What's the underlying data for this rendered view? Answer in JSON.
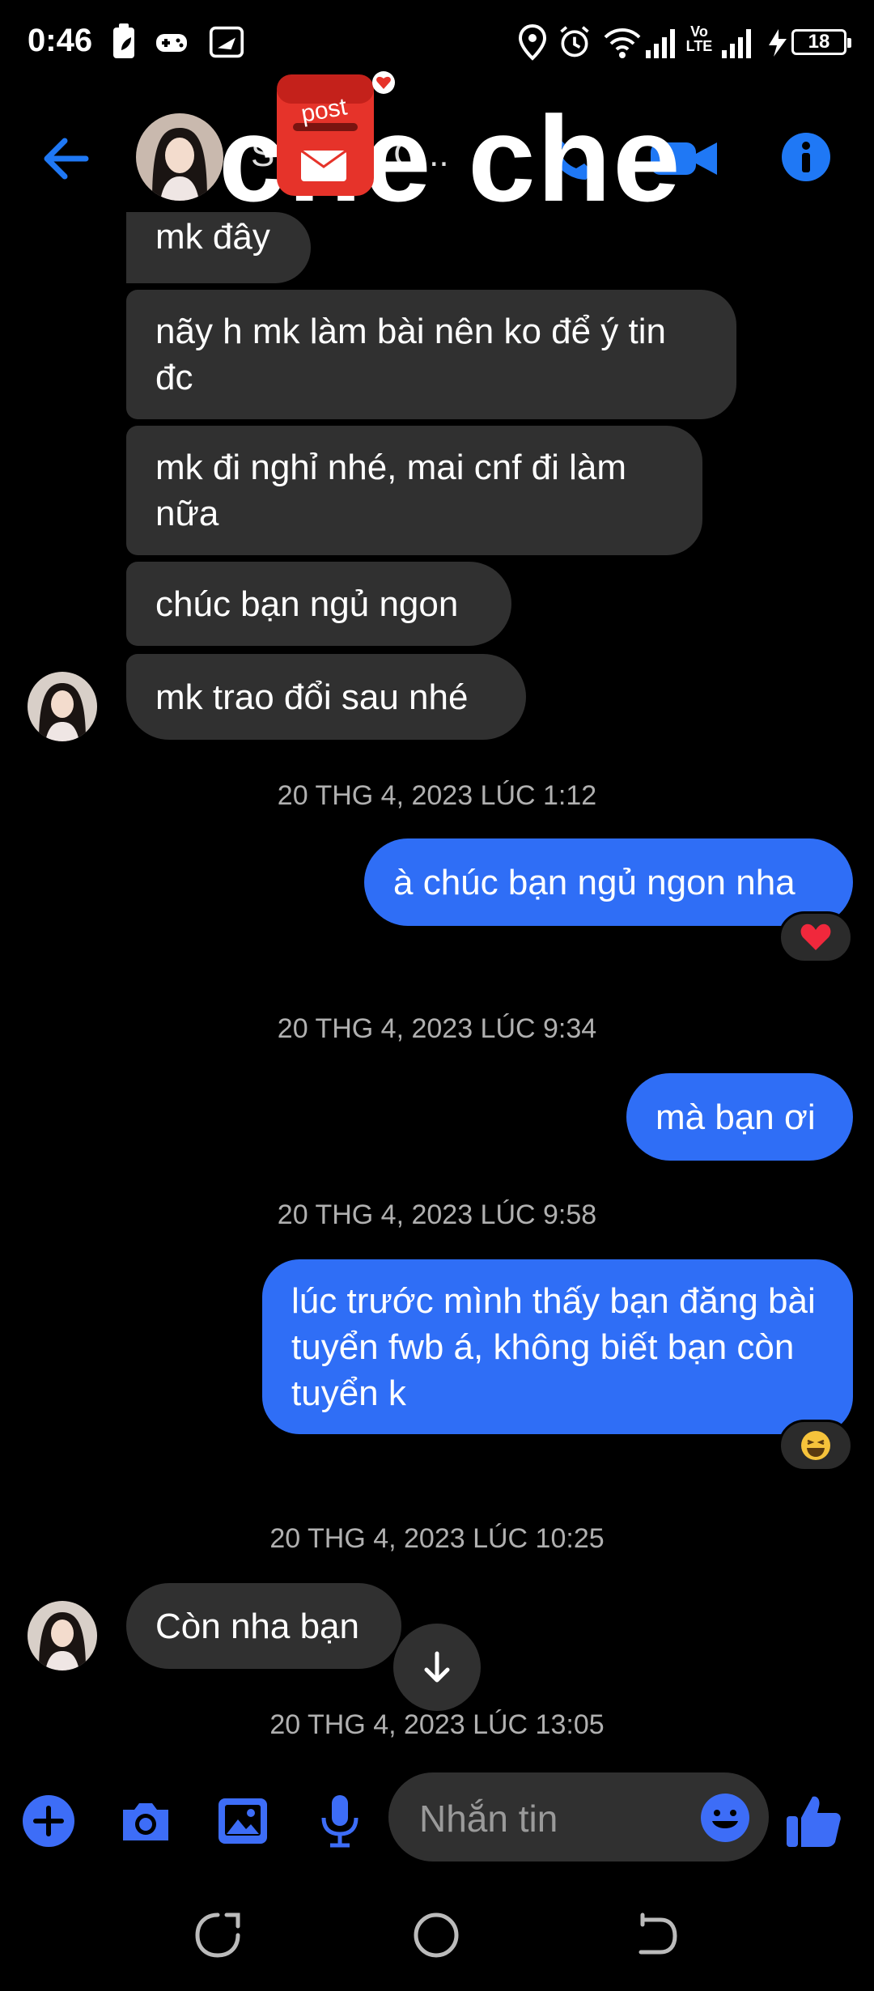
{
  "status_bar": {
    "time": "0:46",
    "battery": "18",
    "volte": "Vo\nLTE"
  },
  "header": {
    "contact_name": "S... Cửa C...",
    "overlay_text": "che che",
    "sticker_text": "post"
  },
  "messages": {
    "m1": "mk đây",
    "m2": "nãy h mk làm bài nên ko để ý tin đc",
    "m3": "mk đi nghỉ nhé, mai cnf đi làm nữa",
    "m4": "chúc bạn ngủ ngon",
    "m5": "mk trao đổi sau nhé",
    "ts1": "20 THG 4, 2023 LÚC 1:12",
    "m6": "à chúc bạn ngủ ngon nha",
    "ts2": "20 THG 4, 2023 LÚC 9:34",
    "m7": "mà bạn ơi",
    "ts3": "20 THG 4, 2023 LÚC 9:58",
    "m8": "lúc trước mình thấy bạn đăng bài tuyển fwb á, không biết bạn còn tuyển k",
    "ts4": "20 THG 4, 2023 LÚC 10:25",
    "m9": "Còn nha bạn",
    "ts5": "20 THG 4, 2023 LÚC 13:05"
  },
  "composer": {
    "placeholder": "Nhắn tin"
  },
  "colors": {
    "accent": "#2f6ef6",
    "incoming_bubble": "#303030",
    "icon_blue": "#1f78f5"
  }
}
